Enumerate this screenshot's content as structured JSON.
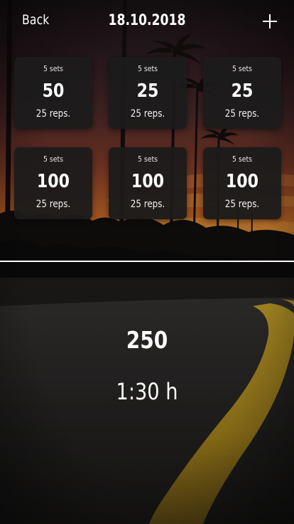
{
  "header": {
    "back_label": "Back",
    "date": "18.10.2018",
    "add_icon": "plus-icon"
  },
  "exercises": [
    {
      "sets": "5 sets",
      "weight": "50",
      "reps": "25 reps."
    },
    {
      "sets": "5 sets",
      "weight": "25",
      "reps": "25 reps."
    },
    {
      "sets": "5 sets",
      "weight": "25",
      "reps": "25 reps."
    },
    {
      "sets": "5 sets",
      "weight": "100",
      "reps": "25 reps."
    },
    {
      "sets": "5 sets",
      "weight": "100",
      "reps": "25 reps."
    },
    {
      "sets": "5 sets",
      "weight": "100",
      "reps": "25 reps."
    }
  ],
  "summary": {
    "total": "250",
    "duration": "1:30 h"
  },
  "colors": {
    "card_bg": "#1c1b1b",
    "road_line": "#c9a21c",
    "sky_glow": "#c8672a"
  }
}
